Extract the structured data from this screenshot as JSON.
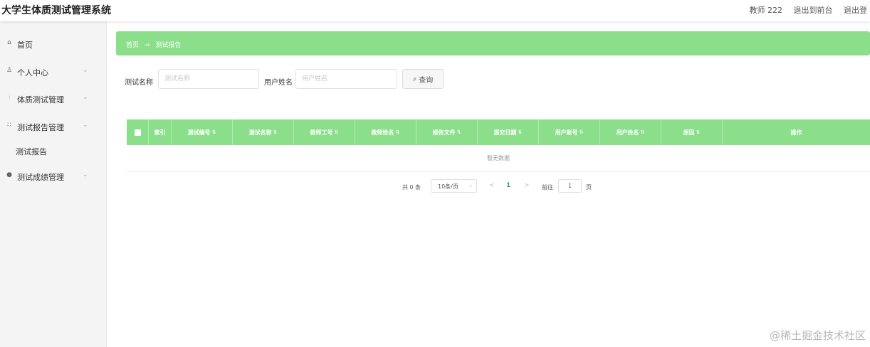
{
  "header": {
    "app_title": "大学生体质测试管理系统",
    "user_label": "教师 222",
    "back_to_frontend": "退出到前台",
    "logout": "退出登"
  },
  "sidebar": {
    "items": [
      {
        "label": "首页",
        "icon": "home-icon",
        "glyph": "⌂",
        "expandable": false
      },
      {
        "label": "个人中心",
        "icon": "user-icon",
        "glyph": "♙",
        "expandable": true
      },
      {
        "label": "体质测试管理",
        "icon": "chart-icon",
        "glyph": "⫶",
        "expandable": true
      },
      {
        "label": "测试报告管理",
        "icon": "grid-icon",
        "glyph": "∷",
        "expandable": true
      },
      {
        "label": "测试报告",
        "icon": "",
        "glyph": "",
        "expandable": false,
        "submenu": true
      },
      {
        "label": "测试成绩管理",
        "icon": "location-icon",
        "glyph": "●",
        "expandable": true
      }
    ],
    "chevron": "⌄"
  },
  "breadcrumb": {
    "home": "首页",
    "separator": "→",
    "current": "测试报告"
  },
  "search": {
    "test_name_label": "测试名称",
    "test_name_placeholder": "测试名称",
    "test_name_value": "",
    "user_name_label": "用户姓名",
    "user_name_placeholder": "用户姓名",
    "user_name_value": "",
    "query_button": "查询",
    "query_icon": "⌕"
  },
  "table": {
    "columns": [
      "索引",
      "测试编号",
      "测试名称",
      "教师工号",
      "教师姓名",
      "报告文件",
      "提交日期",
      "用户账号",
      "用户姓名",
      "原因",
      "操作"
    ],
    "sort_icon": "⇅",
    "empty_text": "暂无数据"
  },
  "pagination": {
    "total": "共 0 条",
    "page_size": "10条/页",
    "prev": "<",
    "current_page": "1",
    "next": ">",
    "goto_label": "前往",
    "goto_value": "1",
    "page_unit": "页"
  },
  "watermark": "@稀土掘金技术社区",
  "colors": {
    "accent_green": "#8bdf8b",
    "page_active": "#2f9e6e"
  }
}
